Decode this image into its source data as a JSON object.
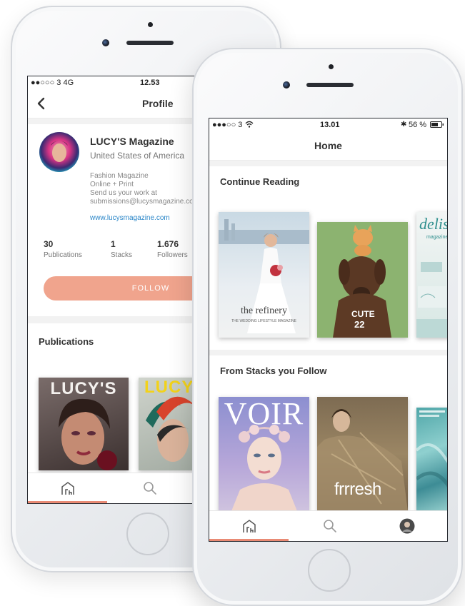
{
  "back_phone": {
    "status": {
      "carrier": "●●○○○ 3  4G",
      "time": "12.53"
    },
    "nav_title": "Profile",
    "profile": {
      "name": "LUCY'S Magazine",
      "location": "United States of America",
      "bio_lines": [
        "Fashion Magazine",
        "Online + Print",
        "Send us your work at",
        "submissions@lucysmagazine.com"
      ],
      "website": "www.lucysmagazine.com",
      "stats": [
        {
          "value": "30",
          "label": "Publications"
        },
        {
          "value": "1",
          "label": "Stacks"
        },
        {
          "value": "1.676",
          "label": "Followers"
        }
      ],
      "follow_label": "FOLLOW"
    },
    "publications_title": "Publications",
    "covers": [
      {
        "title": "LUCY'S"
      },
      {
        "title": "LUCY'S"
      }
    ],
    "tabs": [
      "home-icon",
      "search-icon"
    ]
  },
  "front_phone": {
    "status": {
      "carrier": "●●●○○ 3",
      "time": "13.01",
      "battery": "56 %"
    },
    "nav_title": "Home",
    "continue_title": "Continue Reading",
    "continue_covers": [
      {
        "title": "the refinery",
        "subtitle": "THE WEDDING LIFESTYLE MAGAZINE"
      },
      {
        "title": "CUTE",
        "number": "22"
      },
      {
        "title": "delis",
        "subtitle": "magazine"
      }
    ],
    "stacks_title": "From Stacks you Follow",
    "stack_covers": [
      {
        "title": "VOIR"
      },
      {
        "title": "frrresh"
      },
      {
        "title": ""
      }
    ],
    "tabs": [
      "home-icon",
      "search-icon",
      "avatar"
    ]
  },
  "colors": {
    "accent": "#e98a74",
    "link": "#2a86c8",
    "text": "#333333"
  }
}
